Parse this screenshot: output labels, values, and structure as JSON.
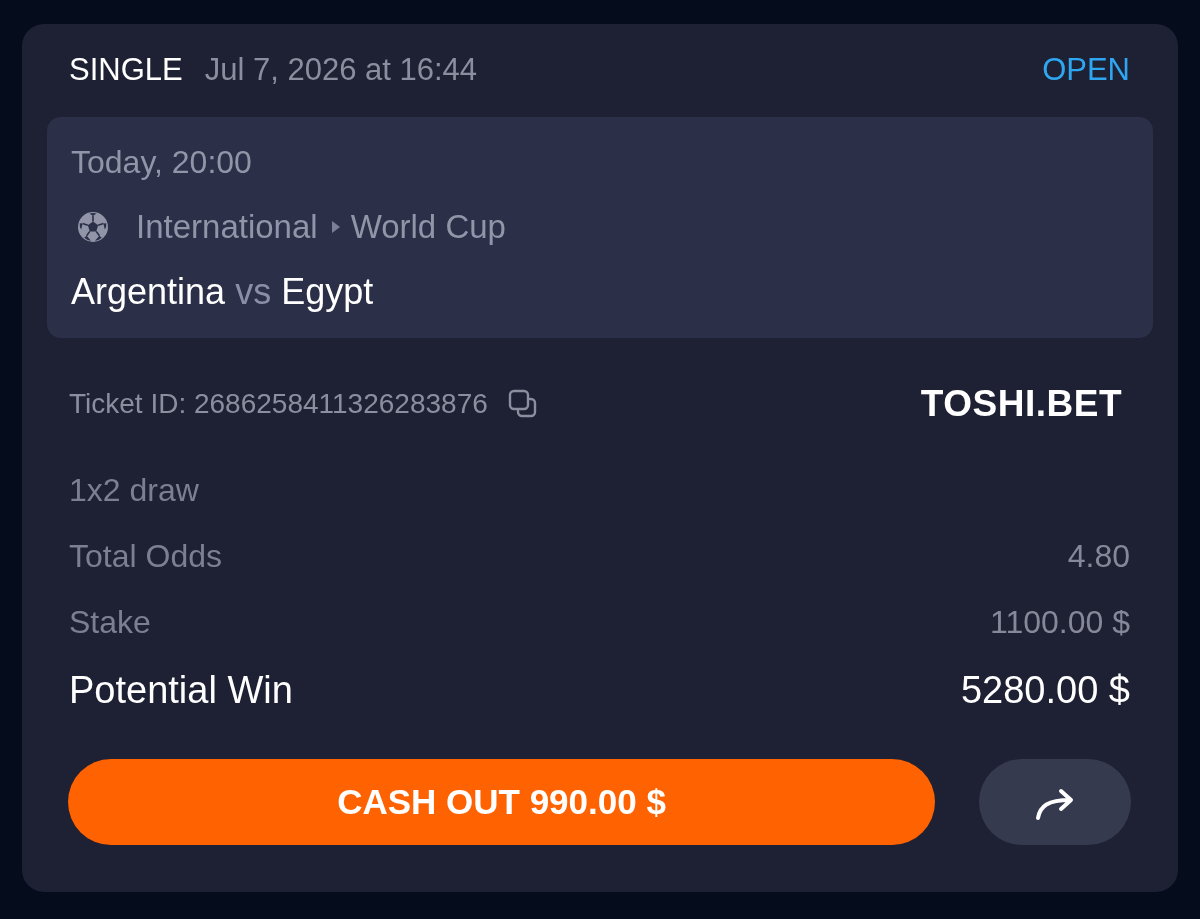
{
  "bet": {
    "type": "SINGLE",
    "placed": "Jul 7, 2026 at 16:44",
    "status": "OPEN"
  },
  "event": {
    "time": "Today, 20:00",
    "breadcrumb": [
      "International",
      "World Cup"
    ],
    "home": "Argentina",
    "vs": "vs",
    "away": "Egypt"
  },
  "ticket": {
    "label": "Ticket ID: 2686258411326283876",
    "brand": "TOSHI.BET"
  },
  "selection": "1x2 draw",
  "summary": [
    {
      "label": "Total Odds",
      "value": "4.80",
      "kind": "detail"
    },
    {
      "label": "Stake",
      "value": "1100.00 $",
      "kind": "detail"
    },
    {
      "label": "Potential Win",
      "value": "5280.00 $",
      "kind": "total"
    }
  ],
  "actions": {
    "cash_out": "CASH OUT 990.00 $"
  }
}
